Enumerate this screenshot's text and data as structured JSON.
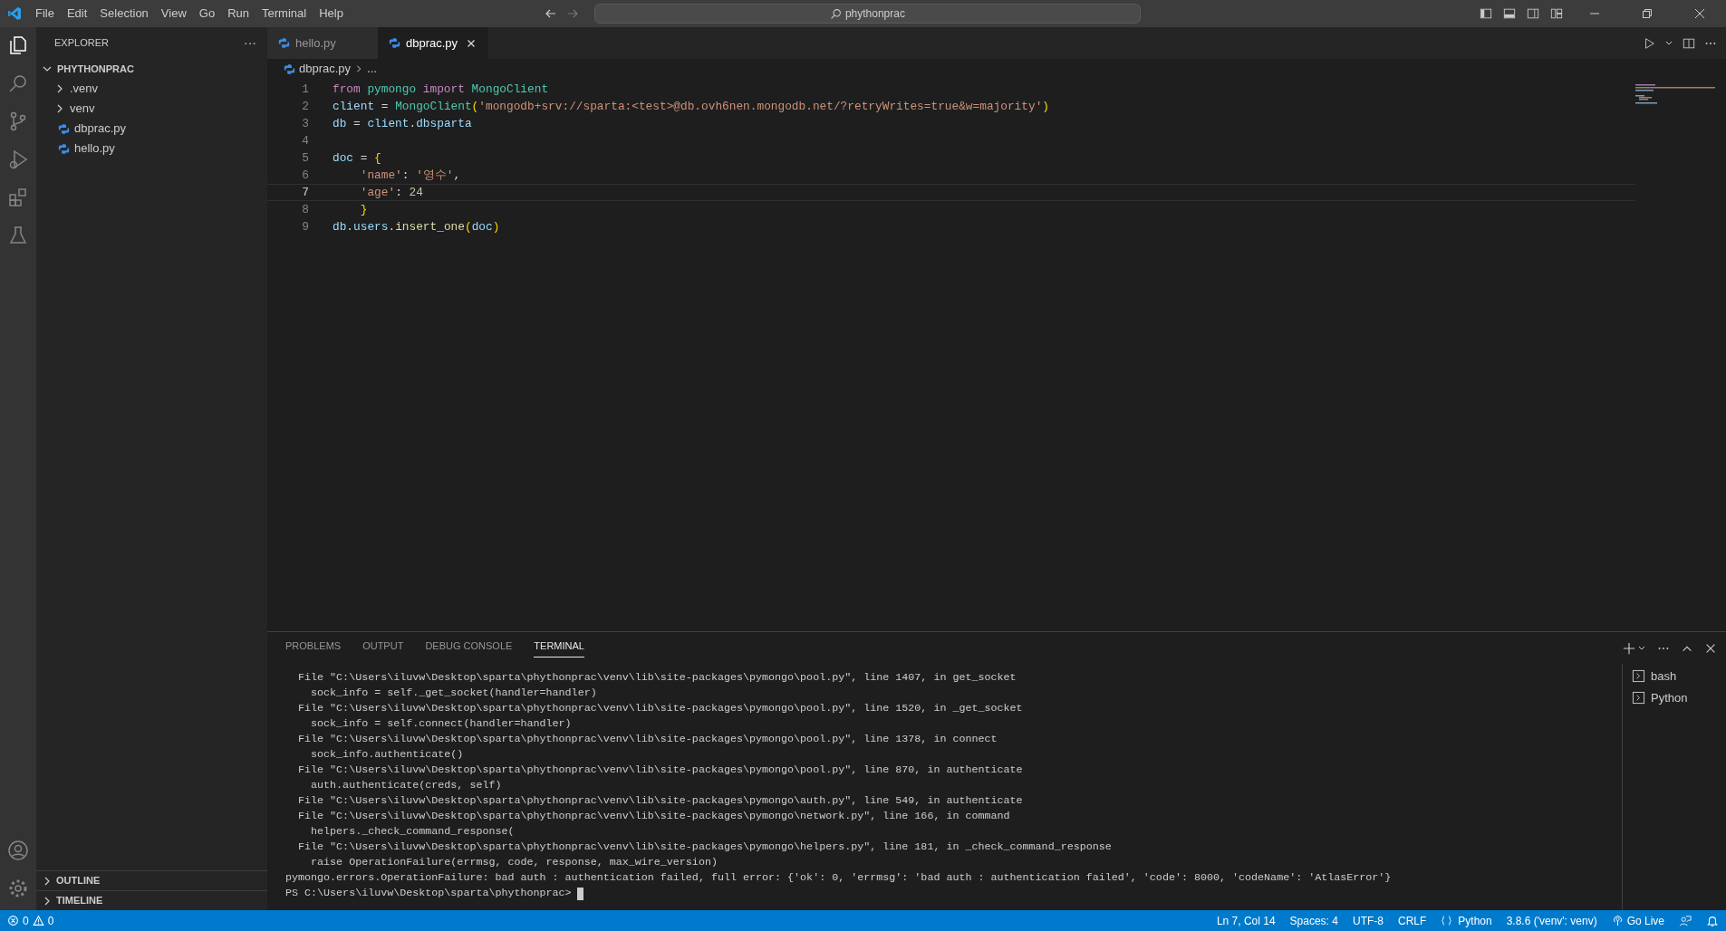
{
  "menu": [
    "File",
    "Edit",
    "Selection",
    "View",
    "Go",
    "Run",
    "Terminal",
    "Help"
  ],
  "command_center": {
    "text": "phythonprac"
  },
  "activity_bar": [
    {
      "kind": "files",
      "selected": true
    },
    {
      "kind": "search",
      "selected": false
    },
    {
      "kind": "source-control",
      "selected": false
    },
    {
      "kind": "run",
      "selected": false
    },
    {
      "kind": "extensions",
      "selected": false
    },
    {
      "kind": "testing",
      "selected": false
    }
  ],
  "sidebar": {
    "title": "EXPLORER",
    "more": "···",
    "tree": [
      {
        "label": "PHYTHONPRAC",
        "kind": "root",
        "expanded": true,
        "children": [
          {
            "label": ".venv",
            "kind": "folder",
            "expanded": false
          },
          {
            "label": "venv",
            "kind": "folder",
            "expanded": false
          },
          {
            "label": "dbprac.py",
            "kind": "file"
          },
          {
            "label": "hello.py",
            "kind": "file"
          }
        ]
      }
    ],
    "sections": [
      {
        "label": "OUTLINE",
        "expanded": false
      },
      {
        "label": "TIMELINE",
        "expanded": false
      }
    ]
  },
  "tabs": [
    {
      "label": "hello.py",
      "selected": false
    },
    {
      "label": "dbprac.py",
      "selected": true
    }
  ],
  "breadcrumb": [
    "dbprac.py",
    "..."
  ],
  "code": [
    {
      "number": "1",
      "current": false,
      "tokens": [
        {
          "text": "from",
          "kind": "keyword"
        },
        {
          "text": " pymongo",
          "kind": "class"
        },
        {
          "text": " import",
          "kind": "keyword"
        },
        {
          "text": " MongoClient",
          "kind": "class"
        }
      ]
    },
    {
      "number": "2",
      "current": false,
      "tokens": [
        {
          "text": "client",
          "kind": "variable"
        },
        {
          "text": " = ",
          "kind": "plain"
        },
        {
          "text": "MongoClient",
          "kind": "class"
        },
        {
          "text": "(",
          "kind": "bracket"
        },
        {
          "text": "'mongodb+srv://sparta:<test>@db.ovh6nen.mongodb.net/?retryWrites=true&w=majority'",
          "kind": "string"
        },
        {
          "text": ")",
          "kind": "bracket"
        }
      ]
    },
    {
      "number": "3",
      "current": false,
      "tokens": [
        {
          "text": "db",
          "kind": "variable"
        },
        {
          "text": " = ",
          "kind": "plain"
        },
        {
          "text": "client",
          "kind": "variable"
        },
        {
          "text": ".",
          "kind": "plain"
        },
        {
          "text": "dbsparta",
          "kind": "variable"
        }
      ]
    },
    {
      "number": "4",
      "current": false
    },
    {
      "number": "5",
      "current": false,
      "tokens": [
        {
          "text": "doc",
          "kind": "variable"
        },
        {
          "text": " = ",
          "kind": "plain"
        },
        {
          "text": "{",
          "kind": "bracket"
        }
      ]
    },
    {
      "number": "6",
      "current": false,
      "tokens": [
        {
          "text": "    'name'",
          "kind": "string"
        },
        {
          "text": ": ",
          "kind": "plain"
        },
        {
          "text": "'영수'",
          "kind": "string"
        },
        {
          "text": ",",
          "kind": "plain"
        }
      ]
    },
    {
      "number": "7",
      "current": true,
      "tokens": [
        {
          "text": "    'age'",
          "kind": "string"
        },
        {
          "text": ": ",
          "kind": "plain"
        },
        {
          "text": "24",
          "kind": "number"
        }
      ]
    },
    {
      "number": "8",
      "current": false,
      "tokens": [
        {
          "text": "    }",
          "kind": "bracket"
        }
      ]
    },
    {
      "number": "9",
      "current": false,
      "tokens": [
        {
          "text": "db",
          "kind": "variable"
        },
        {
          "text": ".",
          "kind": "plain"
        },
        {
          "text": "users",
          "kind": "variable"
        },
        {
          "text": ".",
          "kind": "plain"
        },
        {
          "text": "insert_one",
          "kind": "function"
        },
        {
          "text": "(",
          "kind": "bracket"
        },
        {
          "text": "doc",
          "kind": "variable"
        },
        {
          "text": ")",
          "kind": "bracket"
        }
      ]
    }
  ],
  "panel_tabs": [
    {
      "label": "PROBLEMS",
      "selected": false
    },
    {
      "label": "OUTPUT",
      "selected": false
    },
    {
      "label": "DEBUG CONSOLE",
      "selected": false
    },
    {
      "label": "TERMINAL",
      "selected": true
    }
  ],
  "terminal_lines": [
    "  File \"C:\\Users\\iluvw\\Desktop\\sparta\\phythonprac\\venv\\lib\\site-packages\\pymongo\\pool.py\", line 1407, in get_socket",
    "    sock_info = self._get_socket(handler=handler)",
    "  File \"C:\\Users\\iluvw\\Desktop\\sparta\\phythonprac\\venv\\lib\\site-packages\\pymongo\\pool.py\", line 1520, in _get_socket",
    "    sock_info = self.connect(handler=handler)",
    "  File \"C:\\Users\\iluvw\\Desktop\\sparta\\phythonprac\\venv\\lib\\site-packages\\pymongo\\pool.py\", line 1378, in connect",
    "    sock_info.authenticate()",
    "  File \"C:\\Users\\iluvw\\Desktop\\sparta\\phythonprac\\venv\\lib\\site-packages\\pymongo\\pool.py\", line 870, in authenticate",
    "    auth.authenticate(creds, self)",
    "  File \"C:\\Users\\iluvw\\Desktop\\sparta\\phythonprac\\venv\\lib\\site-packages\\pymongo\\auth.py\", line 549, in authenticate",
    "  File \"C:\\Users\\iluvw\\Desktop\\sparta\\phythonprac\\venv\\lib\\site-packages\\pymongo\\network.py\", line 166, in command",
    "    helpers._check_command_response(",
    "  File \"C:\\Users\\iluvw\\Desktop\\sparta\\phythonprac\\venv\\lib\\site-packages\\pymongo\\helpers.py\", line 181, in _check_command_response",
    "    raise OperationFailure(errmsg, code, response, max_wire_version)",
    "pymongo.errors.OperationFailure: bad auth : authentication failed, full error: {'ok': 0, 'errmsg': 'bad auth : authentication failed', 'code': 8000, 'codeName': 'AtlasError'}"
  ],
  "prompt": "PS C:\\Users\\iluvw\\Desktop\\sparta\\phythonprac>",
  "terminals": [
    {
      "label": "bash"
    },
    {
      "label": "Python"
    }
  ],
  "status_bar": {
    "errors": "0",
    "warnings": "0",
    "right": [
      {
        "text": "Ln 7, Col 14",
        "kind": "text"
      },
      {
        "text": "Spaces: 4",
        "kind": "text"
      },
      {
        "text": "UTF-8",
        "kind": "text"
      },
      {
        "text": "CRLF",
        "kind": "text"
      },
      {
        "text": "Python",
        "kind": "language"
      },
      {
        "text": "3.8.6 ('venv': venv)",
        "kind": "text"
      },
      {
        "text": "Go Live",
        "kind": "live"
      },
      {
        "kind": "feedback"
      },
      {
        "kind": "bell"
      }
    ]
  }
}
